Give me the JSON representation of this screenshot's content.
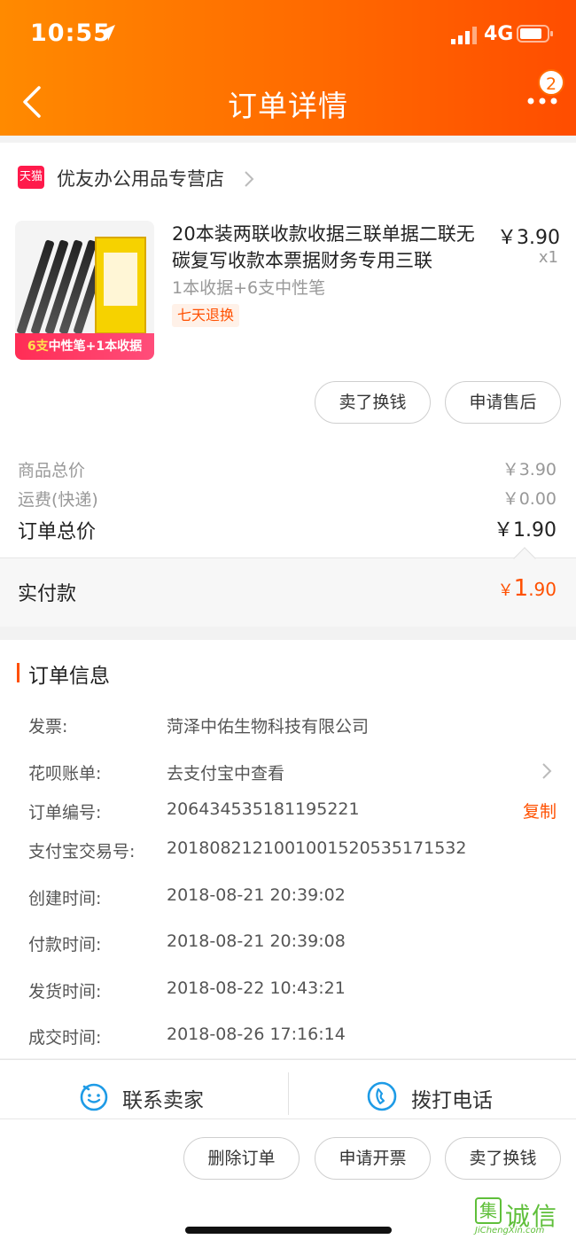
{
  "status_bar": {
    "time": "10:55",
    "network": "4G"
  },
  "nav": {
    "title": "订单详情",
    "badge_count": "2"
  },
  "shop": {
    "logo_text": "天猫",
    "name": "优友办公用品专营店"
  },
  "product": {
    "name": "20本装两联收款收据三联单据二联无碳复写收款本票据财务专用三联",
    "price": "￥3.90",
    "quantity": "x1",
    "sku": "1本收据+6支中性笔",
    "tag": "七天退换",
    "image_banner_a": "6支",
    "image_banner_b": "中性笔+1本收据"
  },
  "item_buttons": {
    "sell_for_cash": "卖了换钱",
    "after_sales": "申请售后"
  },
  "summary": {
    "goods_total_label": "商品总价",
    "goods_total_value": "￥3.90",
    "shipping_label": "运费(快递)",
    "shipping_value": "￥0.00",
    "order_total_label": "订单总价",
    "order_total_value": "￥1.90",
    "paid_label": "实付款",
    "paid_currency": "￥",
    "paid_int": "1",
    "paid_dec": ".90"
  },
  "order_info": {
    "title": "订单信息",
    "rows": [
      {
        "label": "发票:",
        "value": "菏泽中佑生物科技有限公司"
      },
      {
        "label": "花呗账单:",
        "value": "去支付宝中查看"
      },
      {
        "label": "订单编号:",
        "value": "206434535181195221",
        "action": "复制"
      },
      {
        "label": "支付宝交易号:",
        "value": "2018082121001001520535171532"
      },
      {
        "label": "创建时间:",
        "value": "2018-08-21 20:39:02"
      },
      {
        "label": "付款时间:",
        "value": "2018-08-21 20:39:08"
      },
      {
        "label": "发货时间:",
        "value": "2018-08-22 10:43:21"
      },
      {
        "label": "成交时间:",
        "value": "2018-08-26 17:16:14"
      }
    ]
  },
  "contact": {
    "seller": "联系卖家",
    "call": "拨打电话"
  },
  "actions": {
    "delete": "删除订单",
    "invoice": "申请开票",
    "sell": "卖了换钱"
  },
  "watermark": {
    "cn": "诚信",
    "en": "JiChengXin.com"
  },
  "colors": {
    "header_start": "#ff8a00",
    "header_end": "#ff4d00",
    "accent": "#ff5000",
    "contact_icon": "#1e9be6"
  }
}
